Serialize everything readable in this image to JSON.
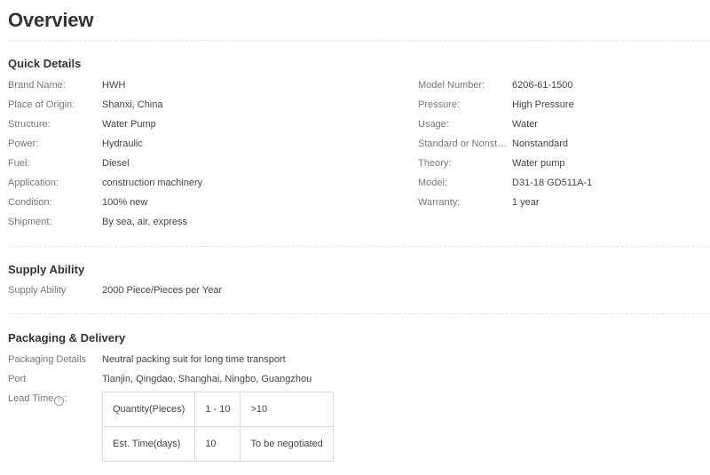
{
  "page": {
    "title": "Overview"
  },
  "quick_details": {
    "heading": "Quick Details",
    "left": [
      {
        "label": "Brand Name:",
        "value": "HWH"
      },
      {
        "label": "Place of Origin:",
        "value": "Shanxi, China"
      },
      {
        "label": "Structure:",
        "value": "Water Pump"
      },
      {
        "label": "Power:",
        "value": "Hydraulic"
      },
      {
        "label": "Fuel:",
        "value": "Diesel"
      },
      {
        "label": "Application:",
        "value": "construction machinery"
      },
      {
        "label": "Condition:",
        "value": "100% new"
      },
      {
        "label": "Shipment:",
        "value": "By sea, air, express"
      }
    ],
    "right": [
      {
        "label": "Model Number:",
        "value": "6206-61-1500"
      },
      {
        "label": "Pressure:",
        "value": "High Pressure"
      },
      {
        "label": "Usage:",
        "value": "Water"
      },
      {
        "label": "Standard or Nonstandard:",
        "value": "Nonstandard"
      },
      {
        "label": "Theory:",
        "value": "Water pump"
      },
      {
        "label": "Model:",
        "value": "D31-18 GD511A-1"
      },
      {
        "label": "Warranty:",
        "value": "1 year"
      }
    ]
  },
  "supply_ability": {
    "heading": "Supply Ability",
    "label": "Supply Ability",
    "value": "2000 Piece/Pieces per Year"
  },
  "packaging": {
    "heading": "Packaging & Delivery",
    "details_label": "Packaging Details",
    "details_value": "Neutral packing suit for long time transport",
    "port_label": "Port",
    "port_value": "Tianjin, Qingdao, Shanghai, Ningbo, Guangzhou",
    "lead_time_label": "Lead Time",
    "help_icon": "help-circle-icon",
    "lead_table": {
      "rows": [
        {
          "label": "Quantity(Pieces)",
          "col1": "1 - 10",
          "col2": ">10"
        },
        {
          "label": "Est. Time(days)",
          "col1": "10",
          "col2": "To be negotiated"
        }
      ]
    }
  }
}
